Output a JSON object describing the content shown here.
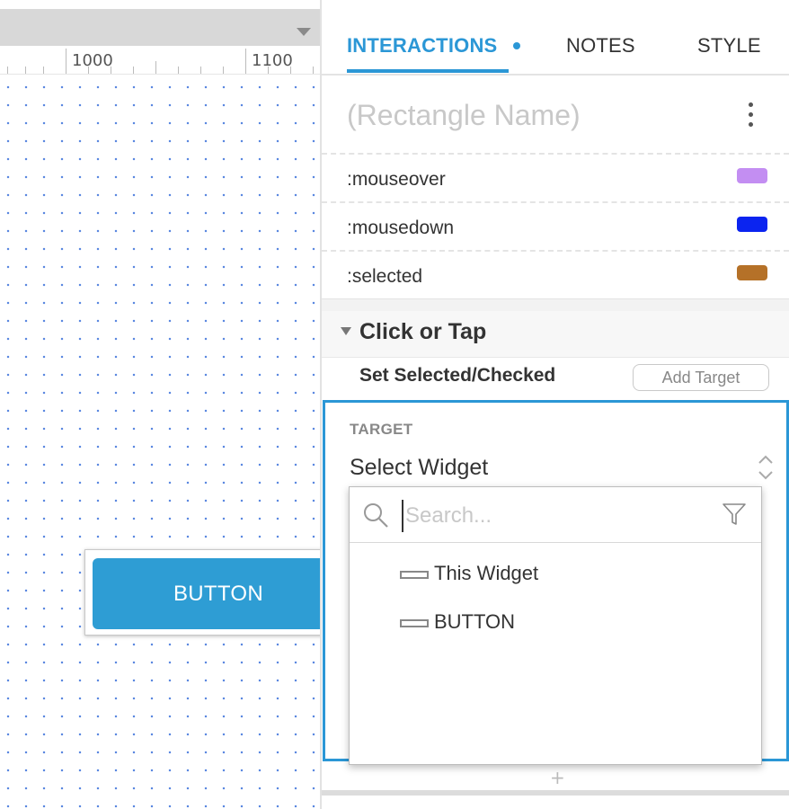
{
  "ruler": {
    "labels": [
      "1000",
      "1100"
    ]
  },
  "canvas": {
    "button_label": "BUTTON"
  },
  "tabs": [
    {
      "label": "INTERACTIONS"
    },
    {
      "label": "NOTES"
    },
    {
      "label": "STYLE"
    }
  ],
  "widget_name": {
    "placeholder": "(Rectangle Name)"
  },
  "states": [
    {
      "label": ":mouseover",
      "color": "#c38ef2"
    },
    {
      "label": ":mousedown",
      "color": "#0b24f0"
    },
    {
      "label": ":selected",
      "color": "#b57128"
    }
  ],
  "event": {
    "label": "Click or Tap"
  },
  "action": {
    "label": "Set Selected/Checked",
    "add_target_label": "Add Target"
  },
  "target": {
    "caption": "TARGET",
    "selected": "Select Widget"
  },
  "dropdown": {
    "search_placeholder": "Search...",
    "items": [
      {
        "label": "This Widget"
      },
      {
        "label": "BUTTON"
      }
    ]
  },
  "bottom": {
    "add_symbol": "+"
  },
  "colors": {
    "accent": "#2b97d6",
    "button": "#2e9dd4"
  }
}
